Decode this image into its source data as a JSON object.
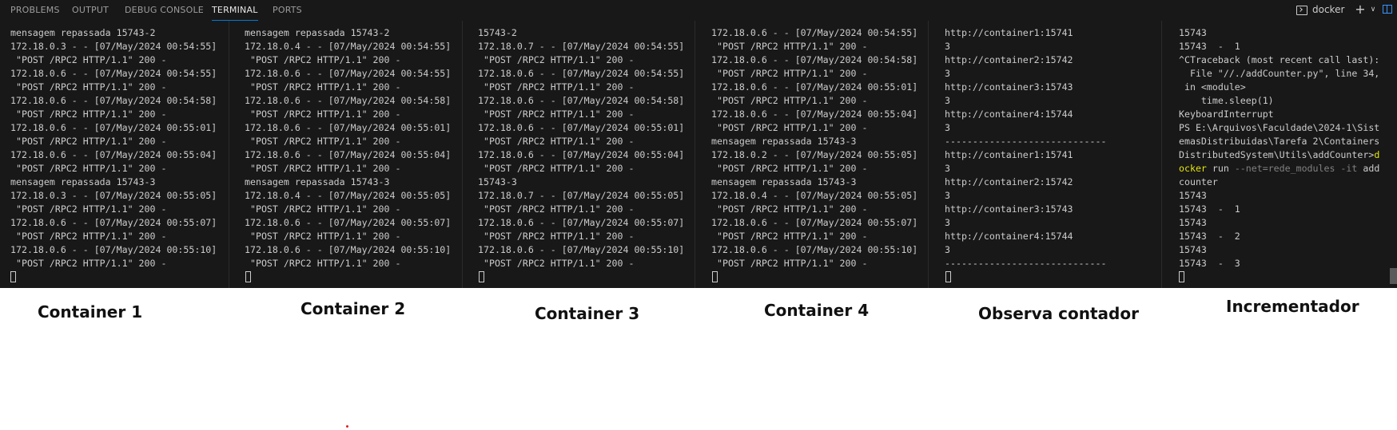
{
  "panel": {
    "tabs": [
      {
        "label": "PROBLEMS"
      },
      {
        "label": "OUTPUT"
      },
      {
        "label": "DEBUG CONSOLE"
      },
      {
        "label": "TERMINAL"
      },
      {
        "label": "PORTS"
      }
    ],
    "active_tab": "TERMINAL",
    "terminal_name": "docker",
    "icons": {
      "terminal": "terminal-icon",
      "new_terminal": "plus-icon",
      "dropdown": "chevron-down-icon",
      "layout": "layout-icon"
    },
    "accent_color": "#0078d4"
  },
  "terminals": [
    {
      "caption": "Container 1",
      "lines": [
        [
          {
            "t": "mensagem repassada 15743-2"
          }
        ],
        [
          {
            "t": "172.18.0.3 - - [07/May/2024 00:54:55]"
          }
        ],
        [
          {
            "t": " \"POST /RPC2 HTTP/1.1\" 200 -"
          }
        ],
        [
          {
            "t": "172.18.0.6 - - [07/May/2024 00:54:55]"
          }
        ],
        [
          {
            "t": " \"POST /RPC2 HTTP/1.1\" 200 -"
          }
        ],
        [
          {
            "t": "172.18.0.6 - - [07/May/2024 00:54:58]"
          }
        ],
        [
          {
            "t": " \"POST /RPC2 HTTP/1.1\" 200 -"
          }
        ],
        [
          {
            "t": "172.18.0.6 - - [07/May/2024 00:55:01]"
          }
        ],
        [
          {
            "t": " \"POST /RPC2 HTTP/1.1\" 200 -"
          }
        ],
        [
          {
            "t": "172.18.0.6 - - [07/May/2024 00:55:04]"
          }
        ],
        [
          {
            "t": " \"POST /RPC2 HTTP/1.1\" 200 -"
          }
        ],
        [
          {
            "t": "mensagem repassada 15743-3"
          }
        ],
        [
          {
            "t": "172.18.0.3 - - [07/May/2024 00:55:05]"
          }
        ],
        [
          {
            "t": " \"POST /RPC2 HTTP/1.1\" 200 -"
          }
        ],
        [
          {
            "t": "172.18.0.6 - - [07/May/2024 00:55:07]"
          }
        ],
        [
          {
            "t": " \"POST /RPC2 HTTP/1.1\" 200 -"
          }
        ],
        [
          {
            "t": "172.18.0.6 - - [07/May/2024 00:55:10]"
          }
        ],
        [
          {
            "t": " \"POST /RPC2 HTTP/1.1\" 200 -"
          }
        ]
      ]
    },
    {
      "caption": "Container 2",
      "lines": [
        [
          {
            "t": "mensagem repassada 15743-2"
          }
        ],
        [
          {
            "t": "172.18.0.4 - - [07/May/2024 00:54:55]"
          }
        ],
        [
          {
            "t": " \"POST /RPC2 HTTP/1.1\" 200 -"
          }
        ],
        [
          {
            "t": "172.18.0.6 - - [07/May/2024 00:54:55]"
          }
        ],
        [
          {
            "t": " \"POST /RPC2 HTTP/1.1\" 200 -"
          }
        ],
        [
          {
            "t": "172.18.0.6 - - [07/May/2024 00:54:58]"
          }
        ],
        [
          {
            "t": " \"POST /RPC2 HTTP/1.1\" 200 -"
          }
        ],
        [
          {
            "t": "172.18.0.6 - - [07/May/2024 00:55:01]"
          }
        ],
        [
          {
            "t": " \"POST /RPC2 HTTP/1.1\" 200 -"
          }
        ],
        [
          {
            "t": "172.18.0.6 - - [07/May/2024 00:55:04]"
          }
        ],
        [
          {
            "t": " \"POST /RPC2 HTTP/1.1\" 200 -"
          }
        ],
        [
          {
            "t": "mensagem repassada 15743-3"
          }
        ],
        [
          {
            "t": "172.18.0.4 - - [07/May/2024 00:55:05]"
          }
        ],
        [
          {
            "t": " \"POST /RPC2 HTTP/1.1\" 200 -"
          }
        ],
        [
          {
            "t": "172.18.0.6 - - [07/May/2024 00:55:07]"
          }
        ],
        [
          {
            "t": " \"POST /RPC2 HTTP/1.1\" 200 -"
          }
        ],
        [
          {
            "t": "172.18.0.6 - - [07/May/2024 00:55:10]"
          }
        ],
        [
          {
            "t": " \"POST /RPC2 HTTP/1.1\" 200 -"
          }
        ]
      ]
    },
    {
      "caption": "Container 3",
      "lines": [
        [
          {
            "t": "15743-2"
          }
        ],
        [
          {
            "t": "172.18.0.7 - - [07/May/2024 00:54:55]"
          }
        ],
        [
          {
            "t": " \"POST /RPC2 HTTP/1.1\" 200 -"
          }
        ],
        [
          {
            "t": "172.18.0.6 - - [07/May/2024 00:54:55]"
          }
        ],
        [
          {
            "t": " \"POST /RPC2 HTTP/1.1\" 200 -"
          }
        ],
        [
          {
            "t": "172.18.0.6 - - [07/May/2024 00:54:58]"
          }
        ],
        [
          {
            "t": " \"POST /RPC2 HTTP/1.1\" 200 -"
          }
        ],
        [
          {
            "t": "172.18.0.6 - - [07/May/2024 00:55:01]"
          }
        ],
        [
          {
            "t": " \"POST /RPC2 HTTP/1.1\" 200 -"
          }
        ],
        [
          {
            "t": "172.18.0.6 - - [07/May/2024 00:55:04]"
          }
        ],
        [
          {
            "t": " \"POST /RPC2 HTTP/1.1\" 200 -"
          }
        ],
        [
          {
            "t": "15743-3"
          }
        ],
        [
          {
            "t": "172.18.0.7 - - [07/May/2024 00:55:05]"
          }
        ],
        [
          {
            "t": " \"POST /RPC2 HTTP/1.1\" 200 -"
          }
        ],
        [
          {
            "t": "172.18.0.6 - - [07/May/2024 00:55:07]"
          }
        ],
        [
          {
            "t": " \"POST /RPC2 HTTP/1.1\" 200 -"
          }
        ],
        [
          {
            "t": "172.18.0.6 - - [07/May/2024 00:55:10]"
          }
        ],
        [
          {
            "t": " \"POST /RPC2 HTTP/1.1\" 200 -"
          }
        ]
      ]
    },
    {
      "caption": "Container 4",
      "lines": [
        [
          {
            "t": "172.18.0.6 - - [07/May/2024 00:54:55]"
          }
        ],
        [
          {
            "t": " \"POST /RPC2 HTTP/1.1\" 200 -"
          }
        ],
        [
          {
            "t": "172.18.0.6 - - [07/May/2024 00:54:58]"
          }
        ],
        [
          {
            "t": " \"POST /RPC2 HTTP/1.1\" 200 -"
          }
        ],
        [
          {
            "t": "172.18.0.6 - - [07/May/2024 00:55:01]"
          }
        ],
        [
          {
            "t": " \"POST /RPC2 HTTP/1.1\" 200 -"
          }
        ],
        [
          {
            "t": "172.18.0.6 - - [07/May/2024 00:55:04]"
          }
        ],
        [
          {
            "t": " \"POST /RPC2 HTTP/1.1\" 200 -"
          }
        ],
        [
          {
            "t": "mensagem repassada 15743-3"
          }
        ],
        [
          {
            "t": "172.18.0.2 - - [07/May/2024 00:55:05]"
          }
        ],
        [
          {
            "t": " \"POST /RPC2 HTTP/1.1\" 200 -"
          }
        ],
        [
          {
            "t": "mensagem repassada 15743-3"
          }
        ],
        [
          {
            "t": "172.18.0.4 - - [07/May/2024 00:55:05]"
          }
        ],
        [
          {
            "t": " \"POST /RPC2 HTTP/1.1\" 200 -"
          }
        ],
        [
          {
            "t": "172.18.0.6 - - [07/May/2024 00:55:07]"
          }
        ],
        [
          {
            "t": " \"POST /RPC2 HTTP/1.1\" 200 -"
          }
        ],
        [
          {
            "t": "172.18.0.6 - - [07/May/2024 00:55:10]"
          }
        ],
        [
          {
            "t": " \"POST /RPC2 HTTP/1.1\" 200 -"
          }
        ]
      ]
    },
    {
      "caption": "Observa contador",
      "lines": [
        [
          {
            "t": "http://container1:15741"
          }
        ],
        [
          {
            "t": "3"
          }
        ],
        [
          {
            "t": "http://container2:15742"
          }
        ],
        [
          {
            "t": "3"
          }
        ],
        [
          {
            "t": "http://container3:15743"
          }
        ],
        [
          {
            "t": "3"
          }
        ],
        [
          {
            "t": "http://container4:15744"
          }
        ],
        [
          {
            "t": "3"
          }
        ],
        [
          {
            "t": "-----------------------------"
          }
        ],
        [
          {
            "t": "http://container1:15741"
          }
        ],
        [
          {
            "t": "3"
          }
        ],
        [
          {
            "t": "http://container2:15742"
          }
        ],
        [
          {
            "t": "3"
          }
        ],
        [
          {
            "t": "http://container3:15743"
          }
        ],
        [
          {
            "t": "3"
          }
        ],
        [
          {
            "t": "http://container4:15744"
          }
        ],
        [
          {
            "t": "3"
          }
        ],
        [
          {
            "t": "-----------------------------"
          }
        ]
      ]
    },
    {
      "caption": "Incrementador",
      "lines": [
        [
          {
            "t": "15743"
          }
        ],
        [
          {
            "t": "15743  -  1"
          }
        ],
        [
          {
            "t": "^CTraceback (most recent call last):"
          }
        ],
        [
          {
            "t": "  File \"//./addCounter.py\", line 34,"
          }
        ],
        [
          {
            "t": " in <module>"
          }
        ],
        [
          {
            "t": "    time.sleep(1)"
          }
        ],
        [
          {
            "t": "KeyboardInterrupt"
          }
        ],
        [
          {
            "t": "PS E:\\Arquivos\\Faculdade\\2024-1\\Sist"
          }
        ],
        [
          {
            "t": "emasDistribuidas\\Tarefa 2\\Containers"
          }
        ],
        [
          {
            "t": "DistributedSystem\\Utils\\addCounter>"
          },
          {
            "t": "d",
            "s": "cmd"
          }
        ],
        [
          {
            "t": "ocker",
            "s": "cmd"
          },
          {
            "t": " run "
          },
          {
            "t": "--net=rede_modules -it",
            "s": "arg"
          },
          {
            "t": " add"
          }
        ],
        [
          {
            "t": "counter"
          }
        ],
        [
          {
            "t": "15743"
          }
        ],
        [
          {
            "t": "15743  -  1"
          }
        ],
        [
          {
            "t": "15743"
          }
        ],
        [
          {
            "t": "15743  -  2"
          }
        ],
        [
          {
            "t": "15743"
          }
        ],
        [
          {
            "t": "15743  -  3"
          }
        ]
      ]
    }
  ]
}
